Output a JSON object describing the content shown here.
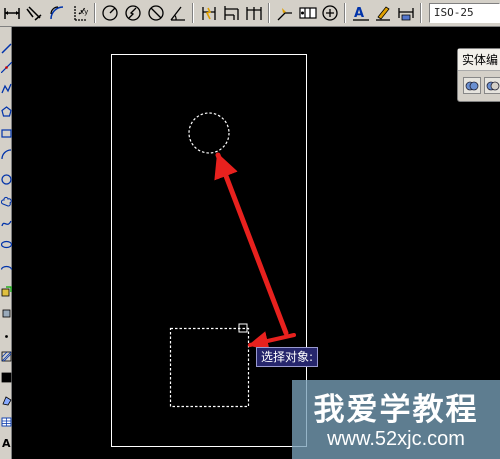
{
  "toolbar": {
    "buttons": [
      "linear-dimension-icon",
      "aligned-dimension-icon",
      "arc-length-icon",
      "ordinate-dimension-icon",
      "radius-dimension-icon",
      "jogged-dimension-icon",
      "diameter-dimension-icon",
      "angular-dimension-icon",
      "quick-dimension-icon",
      "baseline-dimension-icon",
      "continue-dimension-icon",
      "quick-leader-icon",
      "tolerance-icon",
      "center-mark-icon",
      "dimension-edit-icon",
      "dimension-text-edit-icon",
      "dimension-update-icon"
    ],
    "dim_style_value": "ISO-25"
  },
  "left_toolbar": {
    "buttons": [
      "line-icon",
      "construction-line-icon",
      "polyline-icon",
      "polygon-icon",
      "rectangle-icon",
      "arc-icon",
      "circle-icon",
      "revision-cloud-icon",
      "spline-icon",
      "ellipse-icon",
      "ellipse-arc-icon",
      "insert-block-icon",
      "make-block-icon",
      "point-icon",
      "hatch-icon",
      "gradient-icon",
      "region-icon",
      "table-icon",
      "multiline-text-icon"
    ]
  },
  "solid_panel": {
    "title": "实体编",
    "buttons": [
      "union-icon",
      "subtract-icon"
    ]
  },
  "command_tooltip": "选择对象:",
  "watermark": {
    "title": "我爱学教程",
    "url": "www.52xjc.com"
  },
  "colors": {
    "canvas": "#000000",
    "geometry": "#ffffff",
    "arrow": "#e8211e",
    "chrome": "#d4d0c8",
    "tooltip_bg": "#26266c"
  }
}
